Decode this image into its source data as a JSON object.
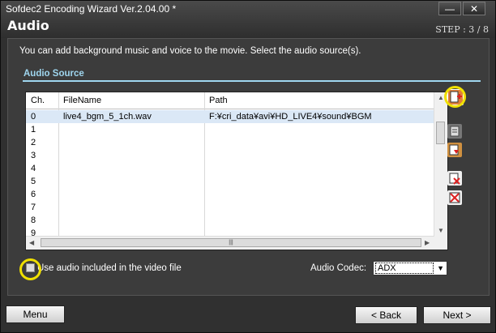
{
  "window": {
    "title": "Sofdec2 Encoding Wizard Ver.2.04.00 *",
    "subtitle": "Audio",
    "step": "STEP : 3 / 8",
    "minimize": "—",
    "close": "✕"
  },
  "description": "You can add background music and voice to the movie. Select the audio source(s).",
  "section_title": "Audio Source",
  "table": {
    "headers": [
      "Ch.",
      "FileName",
      "Path"
    ],
    "rows": [
      {
        "ch": "0",
        "file": "live4_bgm_5_1ch.wav",
        "path": "F:¥cri_data¥avi¥HD_LIVE4¥sound¥BGM"
      },
      {
        "ch": "1",
        "file": "",
        "path": ""
      },
      {
        "ch": "2",
        "file": "",
        "path": ""
      },
      {
        "ch": "3",
        "file": "",
        "path": ""
      },
      {
        "ch": "4",
        "file": "",
        "path": ""
      },
      {
        "ch": "5",
        "file": "",
        "path": ""
      },
      {
        "ch": "6",
        "file": "",
        "path": ""
      },
      {
        "ch": "7",
        "file": "",
        "path": ""
      },
      {
        "ch": "8",
        "file": "",
        "path": ""
      },
      {
        "ch": "9",
        "file": "",
        "path": ""
      }
    ]
  },
  "checkbox_label": "Use audio included in the video file",
  "checkbox_checked": false,
  "codec_label": "Audio Codec:",
  "codec_value": "ADX",
  "buttons": {
    "menu": "Menu",
    "back": "< Back",
    "next": "Next >"
  },
  "highlight_color": "#f0e000",
  "accent_color": "#9fd6ef"
}
